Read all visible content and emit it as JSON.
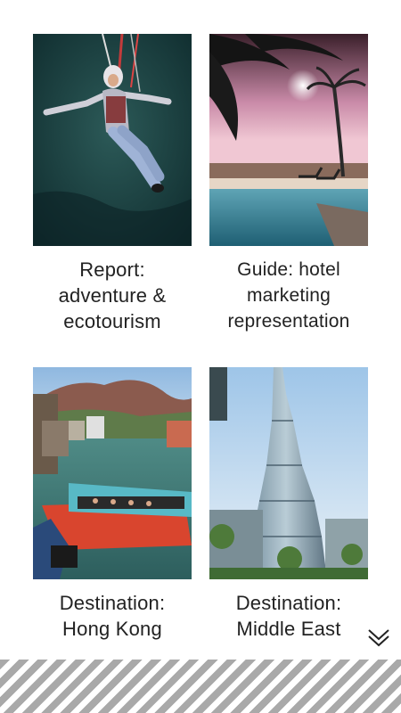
{
  "cards": [
    {
      "caption": "Report:\nadventure &\necotourism"
    },
    {
      "caption": "Guide: hotel\nmarketing\nrepresentation"
    },
    {
      "caption": "Destination:\nHong Kong"
    },
    {
      "caption": "Destination:\nMiddle East"
    }
  ],
  "icons": {
    "more": "double-chevron-down-icon"
  },
  "colors": {
    "footer_stripe": "#a9a9a9",
    "text": "#222222"
  }
}
